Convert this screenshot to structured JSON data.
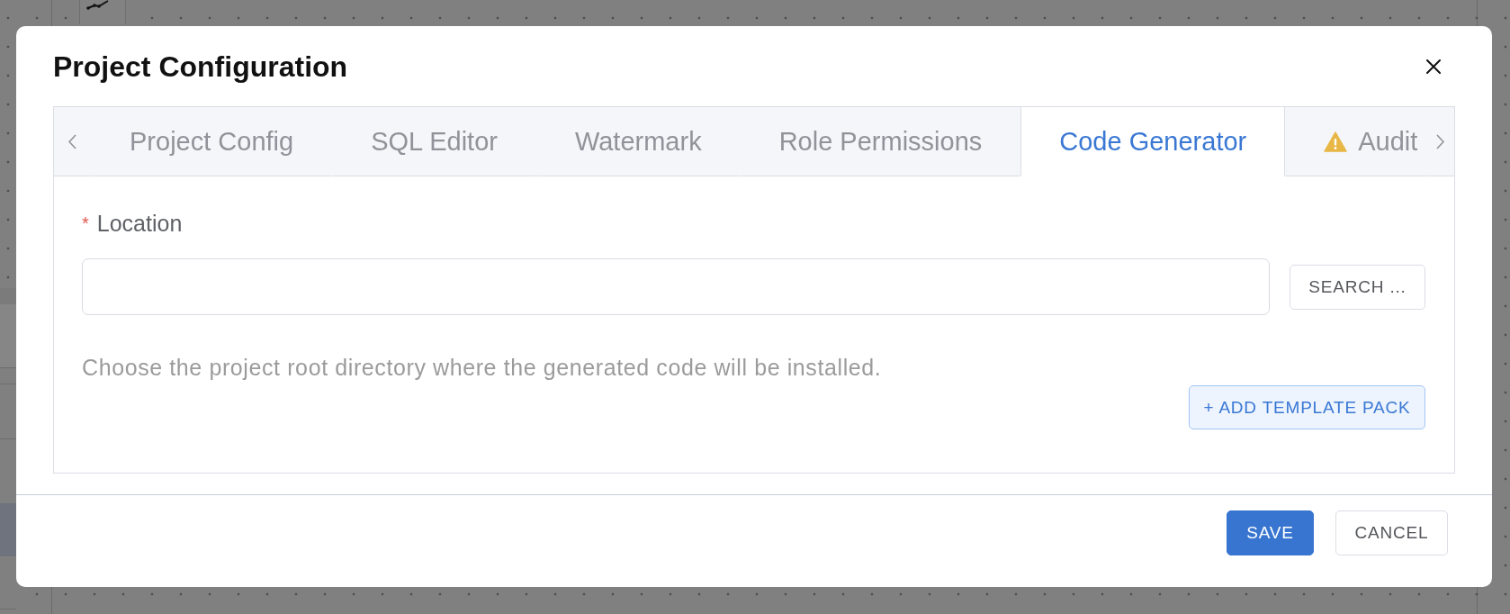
{
  "dialog": {
    "title": "Project Configuration"
  },
  "tabs": [
    {
      "label": "Project Config",
      "selected": false,
      "warning": false
    },
    {
      "label": "SQL Editor",
      "selected": false,
      "warning": false
    },
    {
      "label": "Watermark",
      "selected": false,
      "warning": false
    },
    {
      "label": "Role Permissions",
      "selected": false,
      "warning": false
    },
    {
      "label": "Code Generator",
      "selected": true,
      "warning": false
    },
    {
      "label": "Audit",
      "selected": false,
      "warning": true
    }
  ],
  "location_field": {
    "label": "Location",
    "required_mark": "*",
    "help_text": "Choose the project root directory where the generated code will be installed."
  },
  "search_button": {
    "label": "SEARCH ..."
  },
  "add_template_button": {
    "label": "+ ADD TEMPLATE PACK"
  },
  "footer_buttons": [
    {
      "label": "SAVE",
      "kind": "primary"
    },
    {
      "label": "CANCEL",
      "kind": "secondary"
    }
  ]
}
